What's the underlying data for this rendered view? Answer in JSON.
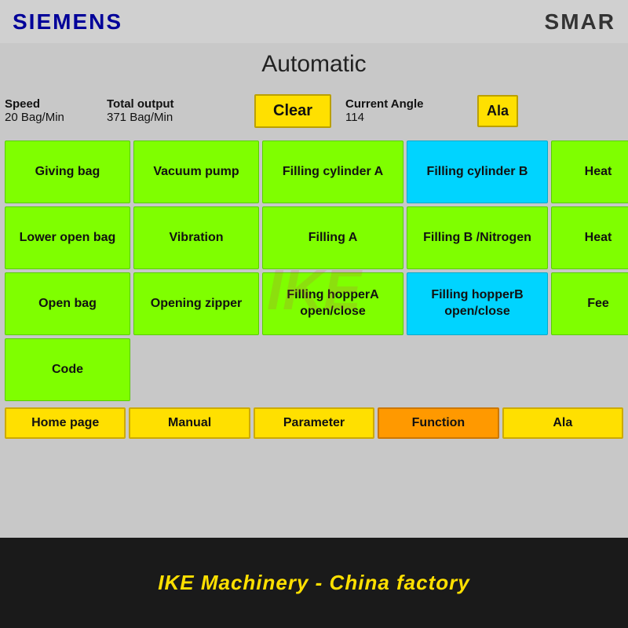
{
  "header": {
    "logo": "SIEMENS",
    "brand": "SMAR"
  },
  "screen": {
    "title": "Automatic",
    "info": {
      "speed_label": "Speed",
      "speed_value": "20",
      "speed_unit": "Bag/Min",
      "output_label": "Total output",
      "output_value": "371",
      "output_unit": "Bag/Min",
      "clear_label": "Clear",
      "angle_label": "Current Angle",
      "angle_value": "114",
      "alarm_label": "Ala"
    },
    "grid": [
      {
        "id": "giving-bag",
        "label": "Giving bag",
        "color": "green",
        "col": 1,
        "row": 1
      },
      {
        "id": "vacuum-pump",
        "label": "Vacuum pump",
        "color": "green",
        "col": 2,
        "row": 1
      },
      {
        "id": "filling-cylinder-a",
        "label": "Filling cylinder A",
        "color": "green",
        "col": 3,
        "row": 1
      },
      {
        "id": "filling-cylinder-b",
        "label": "Filling cylinder B",
        "color": "cyan",
        "col": 4,
        "row": 1
      },
      {
        "id": "heat-1",
        "label": "Heat",
        "color": "green",
        "col": 5,
        "row": 1
      },
      {
        "id": "lower-open-bag",
        "label": "Lower open bag",
        "color": "green",
        "col": 1,
        "row": 2
      },
      {
        "id": "vibration",
        "label": "Vibration",
        "color": "green",
        "col": 2,
        "row": 2
      },
      {
        "id": "filling-a",
        "label": "Filling A",
        "color": "green",
        "col": 3,
        "row": 2
      },
      {
        "id": "filling-b-nitrogen",
        "label": "Filling B /Nitrogen",
        "color": "green",
        "col": 4,
        "row": 2
      },
      {
        "id": "heat-2",
        "label": "Heat",
        "color": "green",
        "col": 5,
        "row": 2
      },
      {
        "id": "open-bag",
        "label": "Open bag",
        "color": "green",
        "col": 1,
        "row": 3
      },
      {
        "id": "opening-zipper",
        "label": "Opening zipper",
        "color": "green",
        "col": 2,
        "row": 3
      },
      {
        "id": "filling-hopper-a",
        "label": "Filling hopperA open/close",
        "color": "green",
        "col": 3,
        "row": 3
      },
      {
        "id": "filling-hopper-b",
        "label": "Filling hopperB open/close",
        "color": "cyan",
        "col": 4,
        "row": 3
      },
      {
        "id": "fee",
        "label": "Fee",
        "color": "green",
        "col": 5,
        "row": 3
      },
      {
        "id": "code",
        "label": "Code",
        "color": "green",
        "col": 1,
        "row": 4
      }
    ],
    "nav": [
      {
        "id": "home-page",
        "label": "Home page",
        "color": "yellow"
      },
      {
        "id": "manual",
        "label": "Manual",
        "color": "yellow"
      },
      {
        "id": "parameter",
        "label": "Parameter",
        "color": "yellow"
      },
      {
        "id": "function",
        "label": "Function",
        "color": "orange"
      },
      {
        "id": "alarm-nav",
        "label": "Ala",
        "color": "yellow"
      }
    ]
  },
  "footer": {
    "text": "IKE Machinery - China factory"
  }
}
